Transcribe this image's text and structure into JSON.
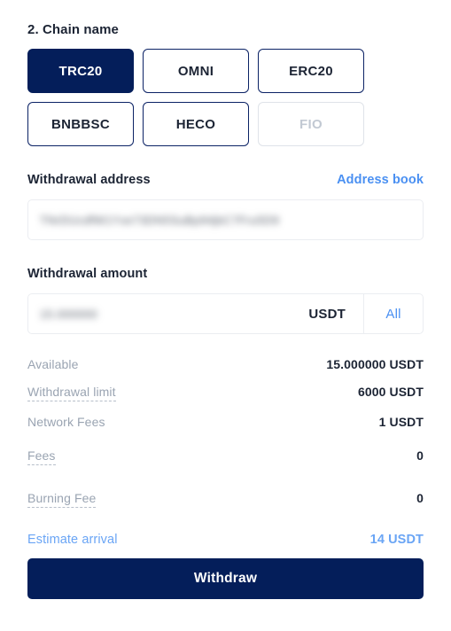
{
  "section": {
    "title": "2. Chain name"
  },
  "chains": [
    {
      "label": "TRC20",
      "state": "selected"
    },
    {
      "label": "OMNI",
      "state": "default"
    },
    {
      "label": "ERC20",
      "state": "default"
    },
    {
      "label": "BNBBSC",
      "state": "default"
    },
    {
      "label": "HECO",
      "state": "default"
    },
    {
      "label": "FIO",
      "state": "disabled"
    }
  ],
  "address": {
    "label": "Withdrawal address",
    "address_book_link": "Address book",
    "value": "TNrDUcdfW1Yxe73DN5SuBp94jbC7Fru5D9",
    "redacted": true
  },
  "amount": {
    "label": "Withdrawal amount",
    "value": "15.000000",
    "redacted": true,
    "unit": "USDT",
    "all_label": "All"
  },
  "summary": [
    {
      "label": "Available",
      "value": "15.000000 USDT",
      "tooltip": false
    },
    {
      "label": "Withdrawal limit",
      "value": "6000 USDT",
      "tooltip": true
    },
    {
      "label": "Network Fees",
      "value": "1 USDT",
      "tooltip": false
    },
    {
      "label": "Fees",
      "value": "0",
      "tooltip": true
    },
    {
      "label": "Burning Fee",
      "value": "0",
      "tooltip": true
    }
  ],
  "estimate": {
    "label": "Estimate arrival",
    "value": "14 USDT"
  },
  "action": {
    "withdraw_label": "Withdraw"
  },
  "colors": {
    "brand_navy": "#041e5a",
    "link_blue": "#4a90f2",
    "estimate_blue": "#6aa5f5",
    "muted_gray": "#9aa4b2",
    "border_light": "#ebedf1",
    "disabled_border": "#dfe3e9",
    "disabled_text": "#c2c9d3"
  }
}
